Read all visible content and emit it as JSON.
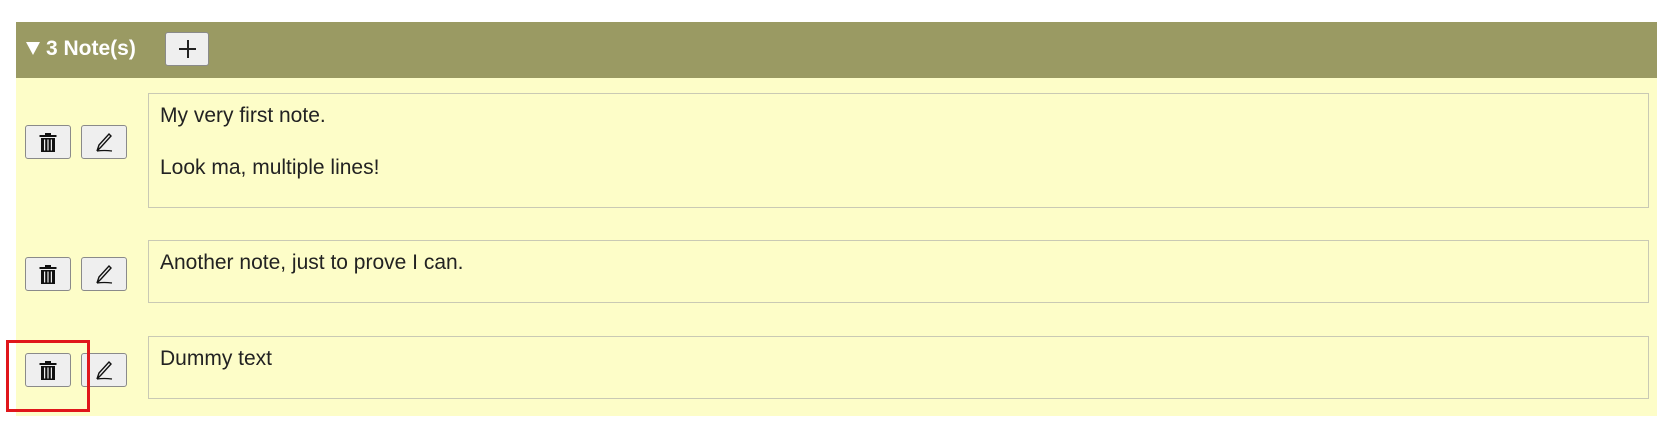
{
  "notes_panel": {
    "title": "3 Note(s)",
    "expanded": true,
    "add_button_icon": "plus-icon",
    "header_color": "#9a9a63",
    "background_color": "#fdfdc8"
  },
  "notes": [
    {
      "lines": [
        "My very first note.",
        "",
        "Look ma, multiple lines!"
      ],
      "delete_icon": "trash-icon",
      "edit_icon": "pencil-icon"
    },
    {
      "lines": [
        "Another note, just to prove I can."
      ],
      "delete_icon": "trash-icon",
      "edit_icon": "pencil-icon"
    },
    {
      "lines": [
        "Dummy text"
      ],
      "delete_icon": "trash-icon",
      "edit_icon": "pencil-icon"
    }
  ],
  "highlight": {
    "target": "delete-note-button-3",
    "color": "#e0161b"
  }
}
